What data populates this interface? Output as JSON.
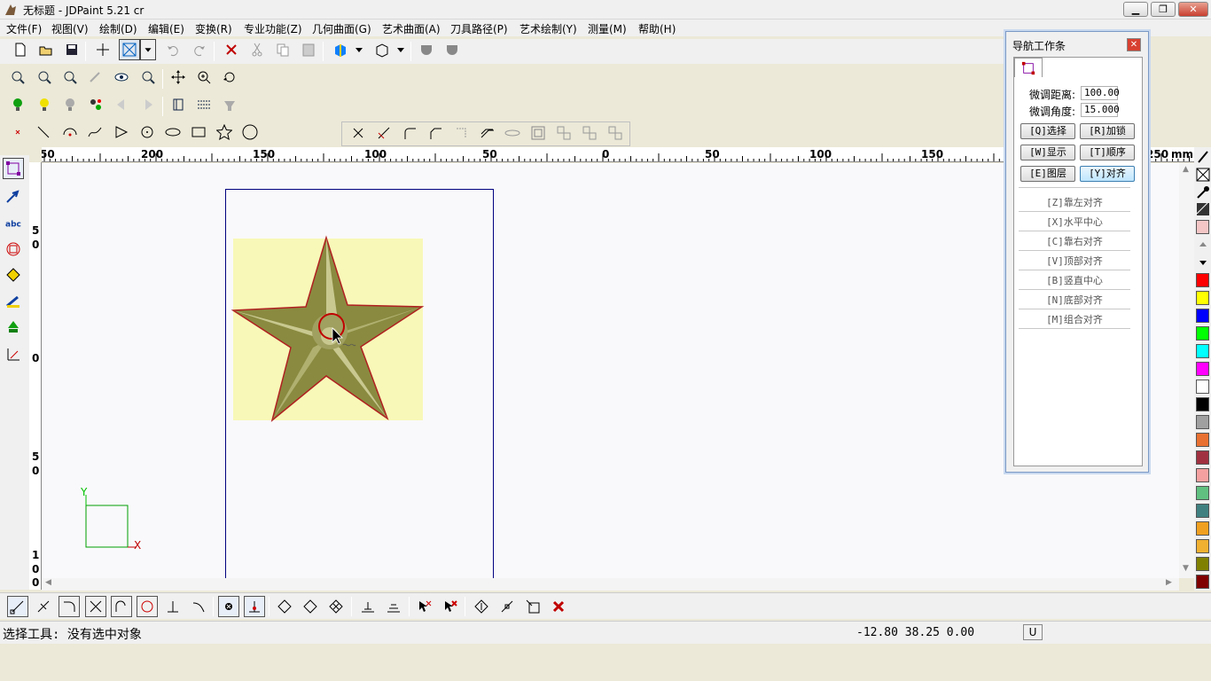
{
  "window": {
    "title": "无标题 - JDPaint 5.21 cr",
    "minimize": "▁",
    "restore": "❐",
    "close": "✕"
  },
  "menu": [
    "文件(F)",
    "视图(V)",
    "绘制(D)",
    "编辑(E)",
    "变换(R)",
    "专业功能(Z)",
    "几何曲面(G)",
    "艺术曲面(A)",
    "刀具路径(P)",
    "艺术绘制(Y)",
    "测量(M)",
    "帮助(H)"
  ],
  "ruler": {
    "h_labels": [
      "50",
      "200",
      "150",
      "100",
      "50",
      "0",
      "50",
      "100",
      "150",
      "250",
      "mm"
    ],
    "v_labels": [
      "5",
      "0",
      "0",
      "5",
      "0",
      "1",
      "0",
      "0"
    ]
  },
  "axis": {
    "x": "X",
    "y": "Y"
  },
  "nav_panel": {
    "title": "导航工作条",
    "dist_label": "微调距离:",
    "dist_value": "100.00",
    "angle_label": "微调角度:",
    "angle_value": "15.000",
    "buttons": [
      "[Q]选择",
      "[R]加锁",
      "[W]显示",
      "[T]顺序",
      "[E]图层",
      "[Y]对齐"
    ],
    "align_items": [
      "[Z]靠左对齐",
      "[X]水平中心",
      "[C]靠右对齐",
      "[V]顶部对齐",
      "[B]竖直中心",
      "[N]底部对齐",
      "[M]组合对齐"
    ]
  },
  "status": {
    "message": "选择工具: 没有选中对象",
    "coords": "-12.80 38.25 0.00",
    "unit_indicator": "U"
  },
  "colors": {
    "palette": [
      "#f4c6c6",
      "#ff0000",
      "#ffff00",
      "#0000ff",
      "#00ff00",
      "#00ffff",
      "#ff00ff",
      "#ffffff",
      "#000000",
      "#a0a0a0",
      "#e87030",
      "#a03040",
      "#f4a0a0",
      "#60c080",
      "#408080",
      "#f0a020",
      "#f0b030",
      "#808000",
      "#800000"
    ],
    "accent": "#000080"
  }
}
